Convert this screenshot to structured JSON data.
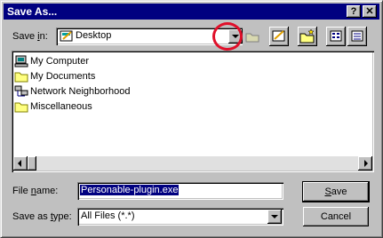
{
  "window": {
    "title": "Save As...",
    "help_label": "?",
    "close_label": "✕"
  },
  "save_in": {
    "label_pre": "Save ",
    "label_acc": "i",
    "label_post": "n:",
    "value": "Desktop"
  },
  "files": [
    {
      "label": "My Computer",
      "icon": "computer-icon"
    },
    {
      "label": "My Documents",
      "icon": "folder-icon"
    },
    {
      "label": "Network Neighborhood",
      "icon": "network-icon"
    },
    {
      "label": "Miscellaneous",
      "icon": "folder-icon"
    }
  ],
  "file_name": {
    "label_pre": "File ",
    "label_acc": "n",
    "label_post": "ame:",
    "value": "Personable-plugin.exe"
  },
  "save_as_type": {
    "label_pre": "Save as ",
    "label_acc": "t",
    "label_post": "ype:",
    "value": "All Files (*.*)"
  },
  "buttons": {
    "save_acc": "S",
    "save_post": "ave",
    "cancel": "Cancel"
  },
  "colors": {
    "titlebar": "#000080",
    "annotation": "#e0102a"
  }
}
